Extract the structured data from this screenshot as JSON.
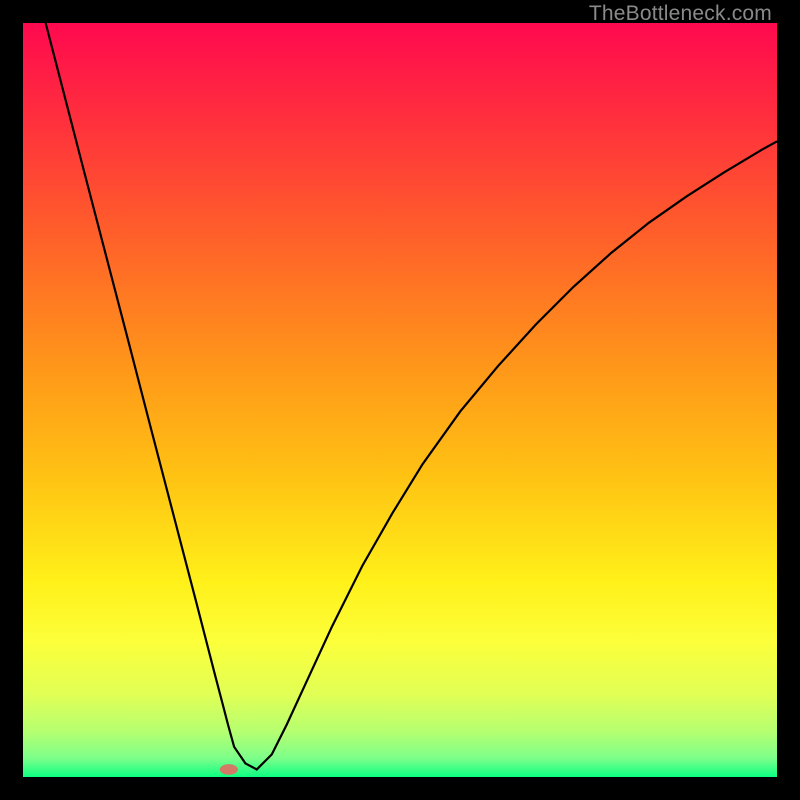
{
  "watermark": "TheBottleneck.com",
  "chart_data": {
    "type": "line",
    "title": "",
    "xlabel": "",
    "ylabel": "",
    "xlim": [
      0,
      100
    ],
    "ylim": [
      0,
      100
    ],
    "background": {
      "type": "vertical-gradient",
      "stops": [
        {
          "pos": 0.0,
          "color": "#ff094f"
        },
        {
          "pos": 0.12,
          "color": "#ff2d3e"
        },
        {
          "pos": 0.28,
          "color": "#ff5f2a"
        },
        {
          "pos": 0.45,
          "color": "#ff951a"
        },
        {
          "pos": 0.6,
          "color": "#ffc213"
        },
        {
          "pos": 0.74,
          "color": "#fff019"
        },
        {
          "pos": 0.82,
          "color": "#fcff3a"
        },
        {
          "pos": 0.89,
          "color": "#e1ff55"
        },
        {
          "pos": 0.94,
          "color": "#b5ff70"
        },
        {
          "pos": 0.975,
          "color": "#7dff8a"
        },
        {
          "pos": 1.0,
          "color": "#0cff82"
        }
      ]
    },
    "series": [
      {
        "name": "bottleneck-curve",
        "color": "#000000",
        "x": [
          3.0,
          5,
          8,
          11,
          14,
          17,
          20,
          23,
          25.5,
          26.5,
          27.2,
          28.0,
          29.5,
          31,
          33,
          35,
          38,
          41,
          45,
          49,
          53,
          58,
          63,
          68,
          73,
          78,
          83,
          88,
          93,
          98,
          100
        ],
        "y": [
          100,
          92.3,
          80.7,
          69.2,
          57.7,
          46.1,
          34.6,
          23.1,
          13.4,
          9.6,
          6.9,
          4.0,
          1.8,
          1.0,
          3.0,
          7.0,
          13.5,
          20.0,
          28.0,
          35.0,
          41.5,
          48.5,
          54.5,
          60.0,
          65.0,
          69.5,
          73.5,
          77.0,
          80.2,
          83.2,
          84.3
        ]
      }
    ],
    "marker": {
      "name": "optimal-point",
      "x": 27.3,
      "y": 1.0,
      "color": "#d17a66",
      "rx": 1.2,
      "ry": 0.7
    }
  }
}
